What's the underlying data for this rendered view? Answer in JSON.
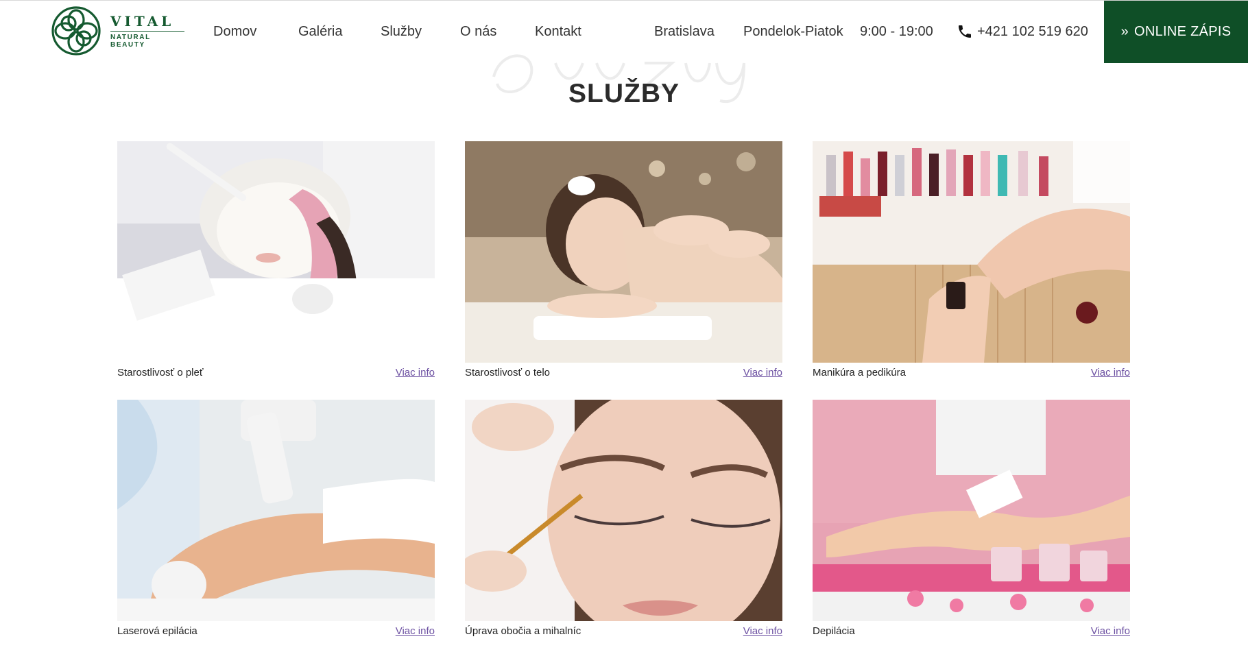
{
  "brand": {
    "name": "VITAL",
    "tagline": "NATURAL BEAUTY"
  },
  "nav": [
    {
      "label": "Domov"
    },
    {
      "label": "Galéria"
    },
    {
      "label": "Služby"
    },
    {
      "label": "O nás"
    },
    {
      "label": "Kontakt"
    }
  ],
  "info": {
    "city": "Bratislava",
    "days": "Pondelok-Piatok",
    "hours": "9:00 - 19:00",
    "phone": "+421 102 519 620"
  },
  "cta": {
    "chevron": "»",
    "label": "ONLINE ZÁPIS"
  },
  "section": {
    "title": "SLUŽBY"
  },
  "services": [
    {
      "title": "Starostlivosť o pleť",
      "link": "Viac info"
    },
    {
      "title": "Starostlivosť o telo",
      "link": "Viac info"
    },
    {
      "title": "Manikúra a pedikúra",
      "link": "Viac info"
    },
    {
      "title": "Laserová epilácia",
      "link": "Viac info"
    },
    {
      "title": "Úprava obočia a mihalníc",
      "link": "Viac info"
    },
    {
      "title": "Depilácia",
      "link": "Viac info"
    }
  ],
  "colors": {
    "brand_green": "#0f4f27",
    "link_purple": "#6b4fa1"
  }
}
